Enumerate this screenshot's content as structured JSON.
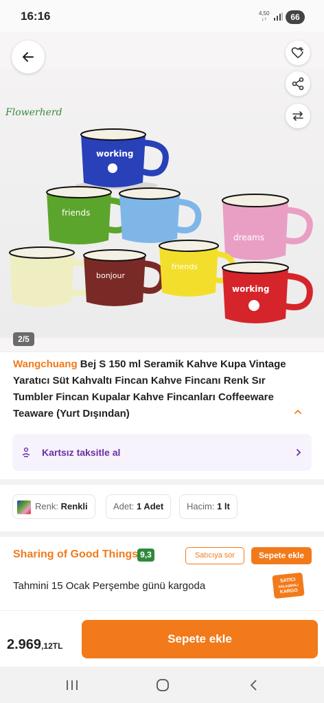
{
  "status_bar": {
    "time": "16:16",
    "net_top": "4,50",
    "net_bottom": "↓↑",
    "battery": "66"
  },
  "hero": {
    "brandmark": "Flowerherd",
    "page_indicator": "2/5"
  },
  "product": {
    "brand": "Wangchuang",
    "title": " Bej S 150 ml Seramik Kahve Kupa Vintage Yaratıcı Süt Kahvaltı Fincan Kahve Fincanı Renk Sır Tumbler Fincan Kupalar Kahve Fincanları Coffeeware Teaware (Yurt Dışından)"
  },
  "installment": {
    "label": "Kartsız taksitle al"
  },
  "variants": [
    {
      "key": "Renk:",
      "value": "Renkli"
    },
    {
      "key": "Adet:",
      "value": "1 Adet"
    },
    {
      "key": "Hacim:",
      "value": "1 lt"
    }
  ],
  "seller": {
    "name": "Sharing of Good Things",
    "rating": "9,3",
    "ask_label": "Satıcıya sor",
    "add_label": "Sepete ekle",
    "shipping": "Tahmini 15 Ocak Perşembe günü kargoda",
    "cargo_badge_1": "SATICI",
    "cargo_badge_2": "ANLAŞMALI",
    "cargo_badge_3": "KARGO"
  },
  "bottom": {
    "price_main": "2.969",
    "price_small": ",12TL",
    "cta": "Sepete ekle"
  },
  "colors": {
    "accent": "#f27a1a",
    "purple": "#6b2fa3",
    "rating_green": "#2e8a3c"
  },
  "icons": [
    "back-arrow-icon",
    "heart-add-icon",
    "share-icon",
    "compare-icon",
    "installment-icon",
    "chevron-up-icon",
    "chevron-right-icon"
  ]
}
